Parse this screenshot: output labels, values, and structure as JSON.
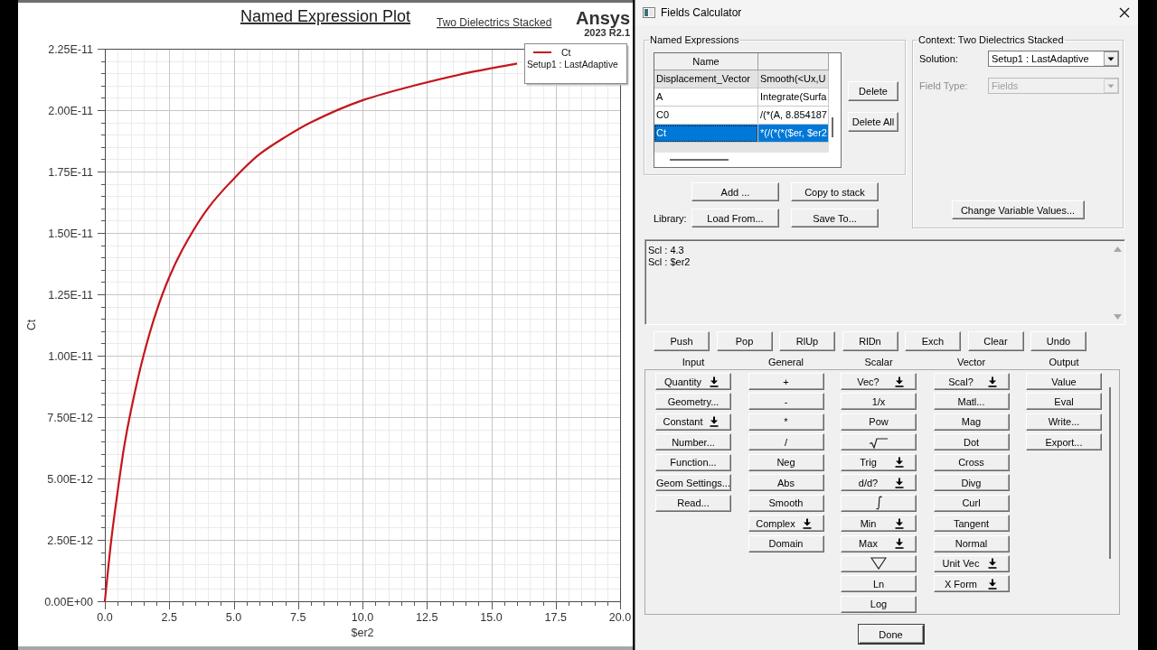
{
  "plot": {
    "design": "Two Dielectrics Stacked",
    "brand": "Ansys",
    "version": "2023 R2.1",
    "legend": {
      "solution": "Setup1 : LastAdaptive"
    },
    "chart_data": {
      "type": "line",
      "title": "Named Expression Plot",
      "xlabel": "$er2",
      "ylabel": "Ct",
      "x": [
        0,
        0.25,
        0.5,
        0.75,
        1,
        1.5,
        2,
        2.5,
        3,
        4,
        5,
        6,
        7,
        8,
        10,
        12,
        14,
        16
      ],
      "series": [
        {
          "name": "Ct",
          "color": "#c4161c",
          "values": [
            0,
            2.5e-12,
            4.5e-12,
            6.3e-12,
            7.7e-12,
            1e-11,
            1.18e-11,
            1.32e-11,
            1.43e-11,
            1.6e-11,
            1.72e-11,
            1.82e-11,
            1.89e-11,
            1.95e-11,
            2.04e-11,
            2.1e-11,
            2.15e-11,
            2.19e-11
          ]
        }
      ],
      "xlim": [
        0,
        20
      ],
      "ylim": [
        0,
        2.25e-11
      ],
      "xticks": [
        {
          "value": 0,
          "label": "0.0"
        },
        {
          "value": 2.5,
          "label": "2.5"
        },
        {
          "value": 5,
          "label": "5.0"
        },
        {
          "value": 7.5,
          "label": "7.5"
        },
        {
          "value": 10,
          "label": "10.0"
        },
        {
          "value": 12.5,
          "label": "12.5"
        },
        {
          "value": 15,
          "label": "15.0"
        },
        {
          "value": 17.5,
          "label": "17.5"
        },
        {
          "value": 20,
          "label": "20.0"
        }
      ],
      "yticks": [
        {
          "value": 0,
          "label": "0.00E+00"
        },
        {
          "value": 2.5e-12,
          "label": "2.50E-12"
        },
        {
          "value": 5e-12,
          "label": "5.00E-12"
        },
        {
          "value": 7.5e-12,
          "label": "7.50E-12"
        },
        {
          "value": 1e-11,
          "label": "1.00E-11"
        },
        {
          "value": 1.25e-11,
          "label": "1.25E-11"
        },
        {
          "value": 1.5e-11,
          "label": "1.50E-11"
        },
        {
          "value": 1.75e-11,
          "label": "1.75E-11"
        },
        {
          "value": 2e-11,
          "label": "2.00E-11"
        },
        {
          "value": 2.25e-11,
          "label": "2.25E-11"
        }
      ],
      "grid": true
    }
  },
  "calculator": {
    "window": {
      "title": "Fields Calculator"
    },
    "named_expressions": {
      "title": "Named Expressions",
      "columns": [
        "Name"
      ],
      "rows": [
        {
          "name": "Displacement_Vector",
          "expression": "Smooth(<Ux,U",
          "read_only": true,
          "selected": false
        },
        {
          "name": "A",
          "expression": "Integrate(Surfa",
          "read_only": false,
          "selected": false
        },
        {
          "name": "C0",
          "expression": "/(*(A, 8.854187",
          "read_only": false,
          "selected": false
        },
        {
          "name": "Ct",
          "expression": "*(/(*(*($er, $er2",
          "read_only": false,
          "selected": true
        }
      ],
      "buttons": [
        "Delete",
        "Delete All"
      ]
    },
    "expression_buttons": [
      "Add ...",
      "Copy to stack"
    ],
    "library": {
      "label": "Library:",
      "buttons": [
        "Load From...",
        "Save To..."
      ]
    },
    "context": {
      "title": "Context: Two Dielectrics Stacked",
      "fields": [
        {
          "label": "Solution:",
          "value": "Setup1 : LastAdaptive",
          "disabled": false
        },
        {
          "label": "Field Type:",
          "value": "Fields",
          "disabled": true
        }
      ],
      "button": "Change Variable Values..."
    },
    "stack": {
      "lines": [
        "Scl : 4.3",
        "Scl : $er2"
      ]
    },
    "stack_buttons": [
      "Push",
      "Pop",
      "RlUp",
      "RlDn",
      "Exch",
      "Clear",
      "Undo"
    ],
    "groups": [
      {
        "title": "Input",
        "buttons": [
          {
            "kind": "menu",
            "label": "Quantity"
          },
          {
            "kind": "plain",
            "label": "Geometry..."
          },
          {
            "kind": "menu",
            "label": "Constant"
          },
          {
            "kind": "plain",
            "label": "Number..."
          },
          {
            "kind": "plain",
            "label": "Function..."
          },
          {
            "kind": "plain",
            "label": "Geom Settings..."
          },
          {
            "kind": "plain",
            "label": "Read..."
          }
        ]
      },
      {
        "title": "General",
        "buttons": [
          {
            "kind": "plain",
            "label": "+"
          },
          {
            "kind": "plain",
            "label": "-"
          },
          {
            "kind": "plain",
            "label": "*"
          },
          {
            "kind": "plain",
            "label": "/"
          },
          {
            "kind": "plain",
            "label": "Neg"
          },
          {
            "kind": "plain",
            "label": "Abs"
          },
          {
            "kind": "plain",
            "label": "Smooth"
          },
          {
            "kind": "menu",
            "label": "Complex"
          },
          {
            "kind": "plain",
            "label": "Domain"
          }
        ]
      },
      {
        "title": "Scalar",
        "buttons": [
          {
            "kind": "menu",
            "label": "Vec?"
          },
          {
            "kind": "plain",
            "label": "1/x"
          },
          {
            "kind": "plain",
            "label": "Pow"
          },
          {
            "kind": "sqrt"
          },
          {
            "kind": "menu",
            "label": "Trig"
          },
          {
            "kind": "menu",
            "label": "d/d?"
          },
          {
            "kind": "integral"
          },
          {
            "kind": "menu",
            "label": "Min"
          },
          {
            "kind": "menu",
            "label": "Max"
          },
          {
            "kind": "nabla"
          },
          {
            "kind": "plain",
            "label": "Ln"
          },
          {
            "kind": "plain",
            "label": "Log"
          }
        ]
      },
      {
        "title": "Vector",
        "buttons": [
          {
            "kind": "menu",
            "label": "Scal?"
          },
          {
            "kind": "plain",
            "label": "Matl..."
          },
          {
            "kind": "plain",
            "label": "Mag"
          },
          {
            "kind": "plain",
            "label": "Dot"
          },
          {
            "kind": "plain",
            "label": "Cross"
          },
          {
            "kind": "plain",
            "label": "Divg"
          },
          {
            "kind": "plain",
            "label": "Curl"
          },
          {
            "kind": "plain",
            "label": "Tangent"
          },
          {
            "kind": "plain",
            "label": "Normal"
          },
          {
            "kind": "menu",
            "label": "Unit Vec"
          },
          {
            "kind": "menu",
            "label": "X Form"
          }
        ]
      },
      {
        "title": "Output",
        "buttons": [
          {
            "kind": "plain",
            "label": "Value"
          },
          {
            "kind": "plain",
            "label": "Eval"
          },
          {
            "kind": "plain",
            "label": "Write..."
          },
          {
            "kind": "plain",
            "label": "Export..."
          }
        ]
      }
    ],
    "done_button": "Done"
  }
}
